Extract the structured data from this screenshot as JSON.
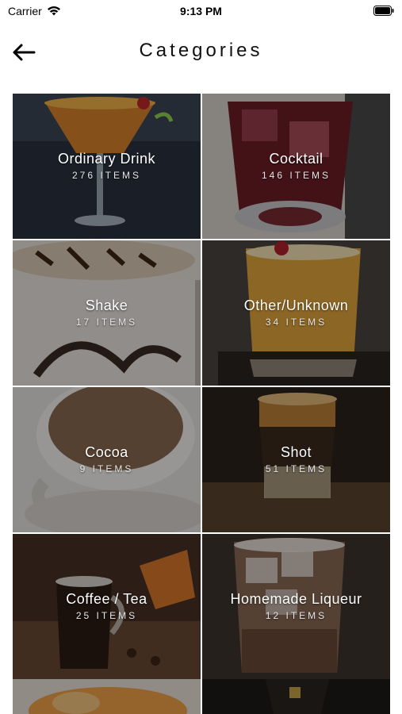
{
  "status_bar": {
    "carrier": "Carrier",
    "time": "9:13 PM"
  },
  "nav": {
    "title": "Categories",
    "back_icon": "arrow-left-icon"
  },
  "categories": [
    {
      "name": "Ordinary Drink",
      "count": "276 ITEMS"
    },
    {
      "name": "Cocktail",
      "count": "146 ITEMS"
    },
    {
      "name": "Shake",
      "count": "17 ITEMS"
    },
    {
      "name": "Other/Unknown",
      "count": "34 ITEMS"
    },
    {
      "name": "Cocoa",
      "count": "9 ITEMS"
    },
    {
      "name": "Shot",
      "count": "51 ITEMS"
    },
    {
      "name": "Coffee / Tea",
      "count": "25 ITEMS"
    },
    {
      "name": "Homemade Liqueur",
      "count": "12 ITEMS"
    }
  ]
}
